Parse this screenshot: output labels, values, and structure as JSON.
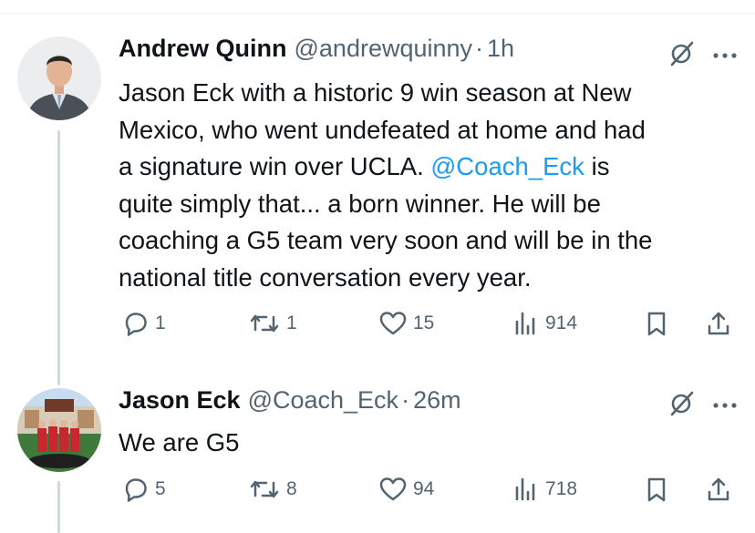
{
  "tweets": [
    {
      "name": "Andrew Quinn",
      "handle": "@andrewquinny",
      "separator": "·",
      "time": "1h",
      "text_before": "Jason Eck with a historic 9 win season at New\nMexico, who went undefeated at home and had\na signature win over UCLA. ",
      "mention": "@Coach_Eck",
      "text_after": " is\nquite simply that... a born winner. He will be\ncoaching a G5 team very soon and will be in the\nnational title conversation every year.",
      "replies": "1",
      "reposts": "1",
      "likes": "15",
      "views": "914"
    },
    {
      "name": "Jason Eck",
      "handle": "@Coach_Eck",
      "separator": "·",
      "time": "26m",
      "text": "We are G5",
      "replies": "5",
      "reposts": "8",
      "likes": "94",
      "views": "718"
    }
  ],
  "icons": [
    "grok-slash-icon",
    "more-icon",
    "reply-icon",
    "repost-icon",
    "like-icon",
    "views-icon",
    "bookmark-icon",
    "share-icon"
  ],
  "colors": {
    "text": "#0f1419",
    "secondary": "#536471",
    "link": "#1d9bf0",
    "thread_line": "#cfd9de"
  }
}
